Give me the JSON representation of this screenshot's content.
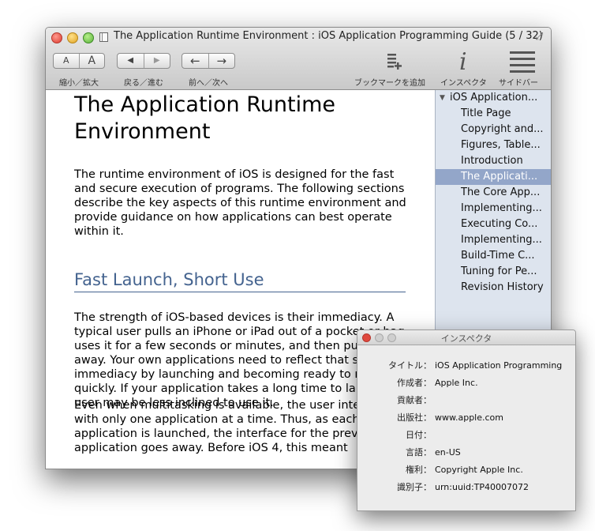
{
  "window": {
    "title": "The Application Runtime Environment : iOS Application Programming Guide (5 / 32)"
  },
  "toolbar": {
    "font_small": "A",
    "font_large": "A",
    "font_label": "縮小／拡大",
    "back_glyph": "◀",
    "forward_glyph": "▶",
    "history_label": "戻る／進む",
    "prev_glyph": "←",
    "next_glyph": "→",
    "page_label": "前へ／次へ",
    "bookmark_label": "ブックマークを追加",
    "inspector_glyph": "i",
    "inspector_label": "インスペクタ",
    "sidebar_label": "サイドバー"
  },
  "content": {
    "title": "The Application Runtime Environment",
    "intro": "The runtime environment of iOS is designed for the fast and secure execution of programs. The following sections describe the key aspects of this runtime environment and provide guidance on how applications can best operate within it.",
    "section_heading": "Fast Launch, Short Use",
    "para1": "The strength of iOS-based devices is their immediacy. A typical user pulls an iPhone or iPad out of a pocket or bag, uses it for a few seconds or minutes, and then puts it away. Your own applications need to reflect that sense of immediacy by launching and becoming ready to run quickly. If your application takes a long time to launch, the user may be less inclined to use it.",
    "para2": "Even when multitasking is available, the user interacts with only one application at a time. Thus, as each application is launched, the interface for the previous application goes away. Before iOS 4, this meant"
  },
  "sidebar": {
    "items": [
      {
        "label": "iOS Application..."
      },
      {
        "label": "Title Page"
      },
      {
        "label": "Copyright and..."
      },
      {
        "label": "Figures, Table..."
      },
      {
        "label": "Introduction"
      },
      {
        "label": "The Applicati..."
      },
      {
        "label": "The Core App..."
      },
      {
        "label": "Implementing..."
      },
      {
        "label": "Executing Co..."
      },
      {
        "label": "Implementing..."
      },
      {
        "label": "Build-Time C..."
      },
      {
        "label": "Tuning for Pe..."
      },
      {
        "label": "Revision History"
      }
    ],
    "selected_index": 5
  },
  "inspector": {
    "title": "インスペクタ",
    "rows": [
      {
        "key": "タイトル：",
        "value": "iOS Application Programming"
      },
      {
        "key": "作成者：",
        "value": "Apple Inc."
      },
      {
        "key": "貢献者：",
        "value": ""
      },
      {
        "key": "出版社：",
        "value": "www.apple.com"
      },
      {
        "key": "日付：",
        "value": ""
      },
      {
        "key": "言語：",
        "value": "en-US"
      },
      {
        "key": "権利：",
        "value": "Copyright Apple Inc."
      },
      {
        "key": "識別子：",
        "value": "urn:uuid:TP40007072"
      }
    ]
  },
  "colors": {
    "heading_blue": "#44638f",
    "sidebar_bg": "#dde4ee",
    "selection": "#93a6c9"
  }
}
